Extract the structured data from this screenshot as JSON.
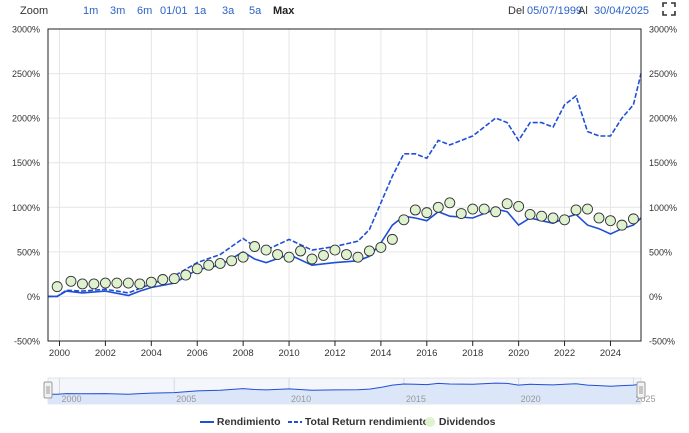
{
  "toolbar": {
    "zoom_label": "Zoom",
    "zoom_buttons": [
      "1m",
      "3m",
      "6m",
      "01/01",
      "1a",
      "3a",
      "5a",
      "Max"
    ],
    "active_zoom": "Max",
    "from_label": "Del",
    "from_value": "05/07/1999",
    "to_label": "Al",
    "to_value": "30/04/2025"
  },
  "colors": {
    "line": "#1f4fd6",
    "dividend_fill": "#dff2d0",
    "grid": "#e6e6e6",
    "navigator_fill": "#dbe6f8"
  },
  "chart_data": {
    "type": "line",
    "x_tick_labels": [
      "2000",
      "2002",
      "2004",
      "2006",
      "2008",
      "2010",
      "2012",
      "2014",
      "2016",
      "2018",
      "2020",
      "2022",
      "2024"
    ],
    "y_tick_labels": [
      "-500%",
      "0%",
      "500%",
      "1000%",
      "1500%",
      "2000%",
      "2500%",
      "3000%"
    ],
    "ylim": [
      -500,
      3000
    ],
    "xlim": [
      1999.5,
      2025.33
    ],
    "series": [
      {
        "name": "Rendimiento",
        "style": "solid",
        "x": [
          1999.5,
          1999.9,
          2000.3,
          2001.0,
          2002.0,
          2003.0,
          2003.5,
          2004.0,
          2005.0,
          2006.0,
          2007.0,
          2008.0,
          2008.5,
          2009.0,
          2010.0,
          2011.0,
          2012.0,
          2013.0,
          2013.5,
          2014.0,
          2014.5,
          2015.0,
          2015.5,
          2016.0,
          2016.5,
          2017.0,
          2018.0,
          2019.0,
          2019.5,
          2020.0,
          2020.5,
          2021.0,
          2021.5,
          2022.0,
          2022.5,
          2023.0,
          2023.5,
          2024.0,
          2024.5,
          2025.0,
          2025.33
        ],
        "y": [
          0,
          0,
          60,
          40,
          60,
          10,
          60,
          100,
          150,
          300,
          350,
          500,
          420,
          380,
          470,
          350,
          380,
          400,
          450,
          600,
          800,
          900,
          880,
          850,
          950,
          900,
          880,
          980,
          950,
          800,
          880,
          850,
          820,
          880,
          920,
          800,
          760,
          700,
          760,
          800,
          880
        ]
      },
      {
        "name": "Total Return rendimiento",
        "style": "dashed",
        "x": [
          1999.5,
          1999.9,
          2000.3,
          2001.0,
          2002.0,
          2003.0,
          2003.5,
          2004.0,
          2005.0,
          2006.0,
          2007.0,
          2008.0,
          2008.5,
          2009.0,
          2010.0,
          2011.0,
          2012.0,
          2013.0,
          2013.5,
          2014.0,
          2014.5,
          2015.0,
          2015.5,
          2016.0,
          2016.5,
          2017.0,
          2018.0,
          2019.0,
          2019.5,
          2020.0,
          2020.5,
          2021.0,
          2021.5,
          2022.0,
          2022.5,
          2023.0,
          2023.5,
          2024.0,
          2024.5,
          2025.0,
          2025.33
        ],
        "y": [
          0,
          0,
          70,
          60,
          80,
          40,
          90,
          140,
          230,
          380,
          470,
          650,
          560,
          520,
          640,
          520,
          560,
          620,
          750,
          1050,
          1350,
          1600,
          1600,
          1550,
          1750,
          1700,
          1800,
          2000,
          1950,
          1750,
          1950,
          1950,
          1900,
          2150,
          2250,
          1850,
          1800,
          1800,
          2000,
          2150,
          2500
        ]
      }
    ],
    "dividends": {
      "name": "Dividendos",
      "x": [
        1999.9,
        2000.5,
        2001.0,
        2001.5,
        2002.0,
        2002.5,
        2003.0,
        2003.5,
        2004.0,
        2004.5,
        2005.0,
        2005.5,
        2006.0,
        2006.5,
        2007.0,
        2007.5,
        2008.0,
        2008.5,
        2009.0,
        2009.5,
        2010.0,
        2010.5,
        2011.0,
        2011.5,
        2012.0,
        2012.5,
        2013.0,
        2013.5,
        2014.0,
        2014.5,
        2015.0,
        2015.5,
        2016.0,
        2016.5,
        2017.0,
        2017.5,
        2018.0,
        2018.5,
        2019.0,
        2019.5,
        2020.0,
        2020.5,
        2021.0,
        2021.5,
        2022.0,
        2022.5,
        2023.0,
        2023.5,
        2024.0,
        2024.5,
        2025.0
      ],
      "y": [
        110,
        170,
        140,
        140,
        150,
        150,
        150,
        140,
        160,
        190,
        200,
        240,
        310,
        350,
        370,
        400,
        440,
        560,
        520,
        470,
        440,
        510,
        420,
        460,
        520,
        470,
        440,
        510,
        550,
        640,
        860,
        970,
        940,
        1000,
        1050,
        930,
        980,
        980,
        950,
        1040,
        1010,
        920,
        900,
        880,
        860,
        970,
        980,
        880,
        850,
        800,
        870
      ]
    },
    "legend_position": "bottom",
    "grid": true
  },
  "navigator": {
    "tick_labels": [
      "2000",
      "2005",
      "2010",
      "2015",
      "2020",
      "2025"
    ]
  },
  "legend": {
    "items": [
      "Rendimiento",
      "Total Return rendimiento",
      "Dividendos"
    ]
  }
}
